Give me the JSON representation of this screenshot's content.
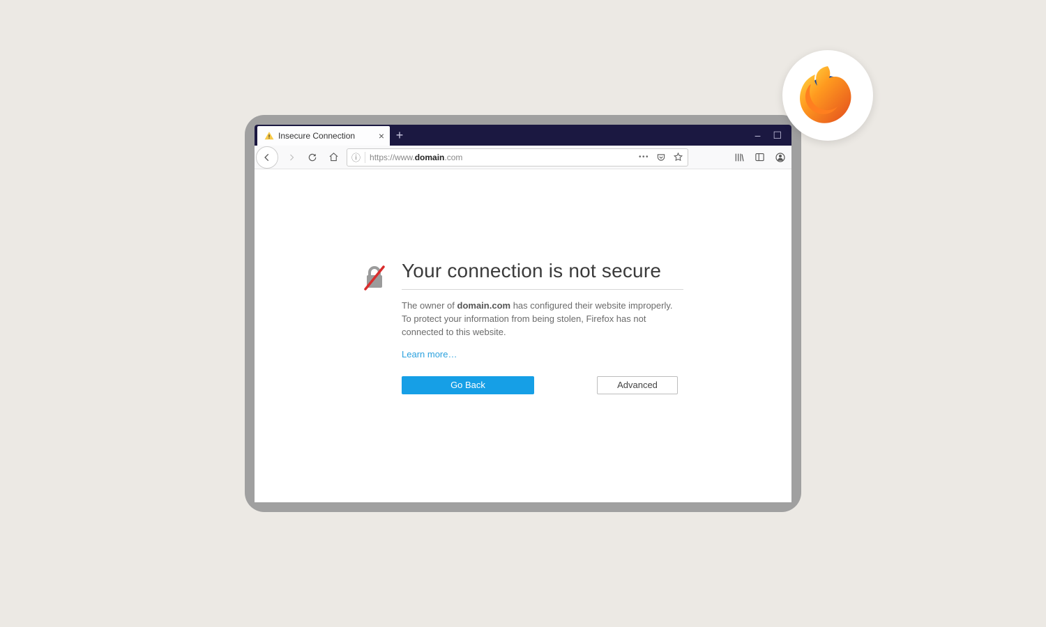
{
  "browser": {
    "tab": {
      "title": "Insecure Connection",
      "icon": "warning-icon"
    },
    "addressbar": {
      "protocol": "https://www.",
      "domain": "domain",
      "tld": ".com"
    },
    "window_controls": {
      "minimize": "–",
      "maximize": "☐",
      "close": "✕"
    }
  },
  "page": {
    "title": "Your connection is not secure",
    "body_prefix": "The owner of ",
    "body_domain": "domain.com",
    "body_suffix": " has configured their website improperly. To protect your information from being stolen, Firefox has not connected to this website.",
    "learn_more": "Learn more…",
    "go_back": "Go Back",
    "advanced": "Advanced"
  },
  "icons": {
    "back": "←",
    "forward": "→",
    "reload": "↻",
    "home": "⌂",
    "info": "ⓘ",
    "dots": "•••",
    "pocket": "⌄",
    "star": "☆",
    "library": "|||\\",
    "sidebar": "▣",
    "account": "◉",
    "plus": "+",
    "close": "×"
  },
  "badge": {
    "name": "firefox-logo"
  }
}
